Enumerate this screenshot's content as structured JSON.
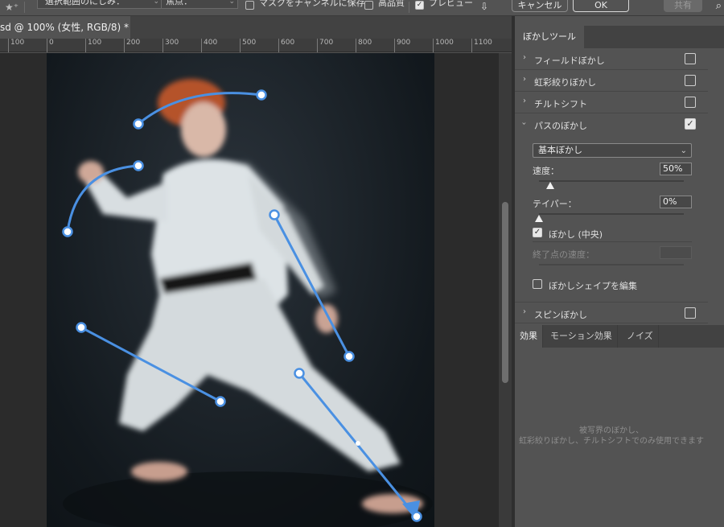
{
  "options_bar": {
    "blur_label": "選択範囲のにじみ：",
    "focus_label": "焦点：",
    "save_mask_label": "マスクをチャンネルに保存",
    "save_mask_checked": false,
    "high_quality_label": "高品質",
    "high_quality_checked": false,
    "preview_label": "プレビュー",
    "preview_checked": true,
    "cancel_label": "キャンセル",
    "ok_label": "OK",
    "share_label": "共有",
    "icons": [
      "star-tool-icon",
      "pin-icon",
      "search-icon"
    ]
  },
  "document": {
    "tab_title": "sd @ 100% (女性, RGB/8) *"
  },
  "ruler": {
    "labels": [
      "100",
      "0",
      "100",
      "200",
      "300",
      "400",
      "500",
      "600",
      "700",
      "800",
      "900",
      "1000",
      "1100"
    ]
  },
  "panel": {
    "tab_label": "ぼかしツール",
    "items": [
      {
        "label": "フィールドぼかし",
        "expanded": false,
        "checked": false
      },
      {
        "label": "虹彩絞りぼかし",
        "expanded": false,
        "checked": false
      },
      {
        "label": "チルトシフト",
        "expanded": false,
        "checked": false
      },
      {
        "label": "パスのぼかし",
        "expanded": true,
        "checked": true
      },
      {
        "label": "スピンぼかし",
        "expanded": false,
        "checked": false
      }
    ],
    "path_blur": {
      "mode_value": "基本ぼかし",
      "speed_label": "速度：",
      "speed_value": "50%",
      "speed_fraction": 0.08,
      "taper_label": "テイパー：",
      "taper_value": "0%",
      "taper_fraction": 0,
      "centered_label": "ぼかし (中央)",
      "centered_checked": true,
      "end_speed_label": "終了点の速度：",
      "edit_shape_label": "ぼかしシェイプを編集",
      "edit_shape_checked": false
    },
    "sub_tabs": [
      "効果",
      "モーション効果",
      "ノイズ"
    ],
    "effects_note_line1": "被写界のぼかし、",
    "effects_note_line2": "虹彩絞りぼかし、チルトシフトでのみ使用できます"
  },
  "colors": {
    "path_blue": "#4a90e2",
    "panel_bg": "#535353",
    "dark_bg": "#424242"
  }
}
